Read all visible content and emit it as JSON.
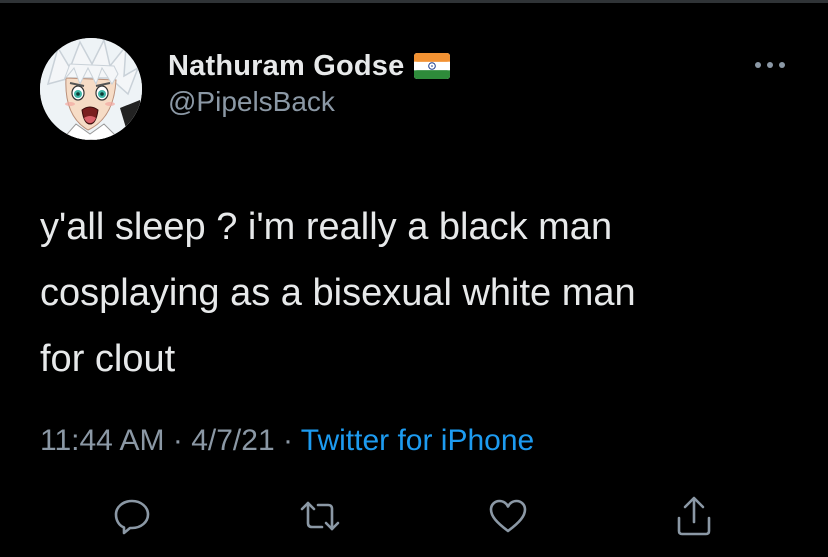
{
  "tweet": {
    "author": {
      "display_name": "Nathuram Godse",
      "flag": "india-flag-icon",
      "handle": "@PipelsBack",
      "avatar": "anime-avatar"
    },
    "text": "y'all sleep ? i'm really a black man\ncosplaying as a bisexual white man\nfor clout",
    "time": "11:44 AM",
    "date": "4/7/21",
    "separator": "·",
    "source": "Twitter for iPhone",
    "more_icon": "more-options-icon"
  },
  "actions": [
    {
      "name": "reply",
      "icon": "reply-icon"
    },
    {
      "name": "retweet",
      "icon": "retweet-icon"
    },
    {
      "name": "like",
      "icon": "like-icon"
    },
    {
      "name": "share",
      "icon": "share-icon"
    }
  ],
  "colors": {
    "background": "#000000",
    "text": "#e7e9ea",
    "secondary": "#8b98a5",
    "accent": "#1d9bf0"
  }
}
